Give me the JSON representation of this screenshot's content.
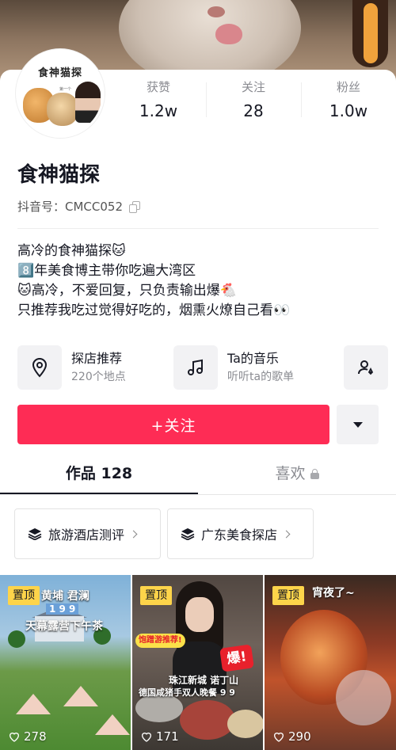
{
  "profile": {
    "avatar_text": "食神猫探",
    "avatar_tag": "第一个",
    "nickname": "食神猫探",
    "douyin_id": "抖音号：CMCC052"
  },
  "stats": [
    {
      "label": "获赞",
      "value": "1.2w"
    },
    {
      "label": "关注",
      "value": "28"
    },
    {
      "label": "粉丝",
      "value": "1.0w"
    }
  ],
  "bio": [
    "高冷的食神猫探🐱",
    "8️⃣年美食博主带你吃遍大湾区",
    "🐱高冷，不爱回复，只负责输出爆🐔",
    "只推荐我吃过觉得好吃的，烟熏火燎自己看👀"
  ],
  "services": [
    {
      "title": "探店推荐",
      "subtitle": "220个地点",
      "icon": "location-pin-icon"
    },
    {
      "title": "Ta的音乐",
      "subtitle": "听听ta的歌单",
      "icon": "music-note-icon"
    },
    {
      "icon": "add-friend-icon"
    }
  ],
  "actions": {
    "follow_label": "+关注",
    "more_icon": "dropdown-triangle-icon"
  },
  "tabs": [
    {
      "label": "作品 128",
      "active": true
    },
    {
      "label": "喜欢",
      "locked": true
    }
  ],
  "collections": [
    {
      "label": "旅游酒店测评",
      "icon": "layers-icon"
    },
    {
      "label": "广东美食探店",
      "icon": "layers-icon"
    }
  ],
  "videos": [
    {
      "pinned": "置顶",
      "title_line1": "黄埔 君澜",
      "title_line2": "1 9 9",
      "title_line3": "天幕露营下午茶",
      "likes": "278"
    },
    {
      "pinned": "置顶",
      "tag": "饱蹭游推荐!",
      "badge": "爆!",
      "title_line1": "珠江新城 诺丁山",
      "title_line2": "德国咸猪手双人晚餐 9 9",
      "likes": "171"
    },
    {
      "pinned": "置顶",
      "title_line1": "宵夜了~",
      "likes": "290"
    }
  ],
  "colors": {
    "follow": "#fe2c55",
    "pinned": "#fdd44a",
    "text_primary": "#161823",
    "text_secondary": "#8a8b91"
  }
}
